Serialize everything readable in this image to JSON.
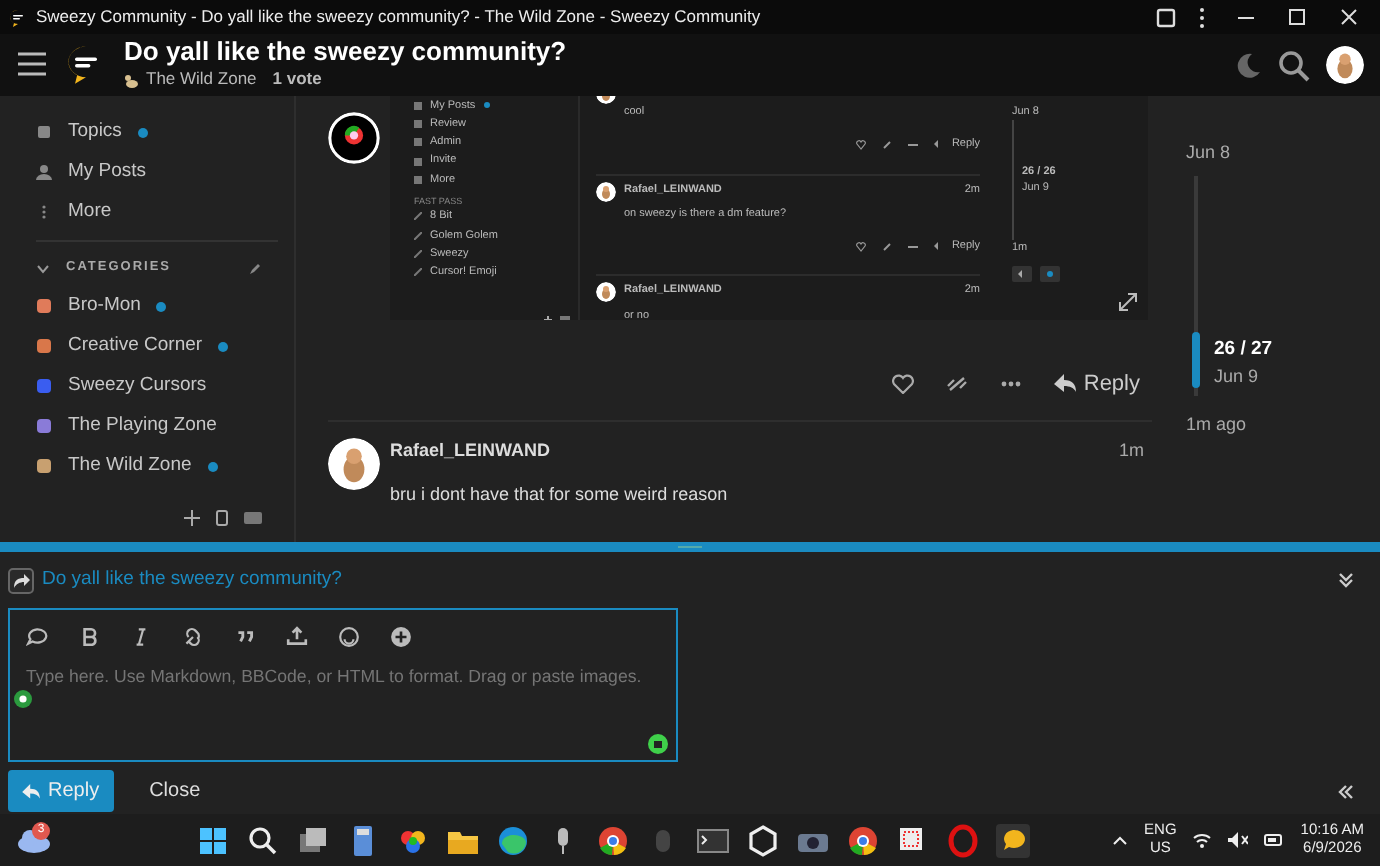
{
  "window": {
    "title": "Sweezy Community - Do yall like the sweezy community? - The Wild Zone - Sweezy Community"
  },
  "header": {
    "title": "Do yall like the sweezy community?",
    "category": "The Wild Zone",
    "votes": "1 vote"
  },
  "sidebar": {
    "items": [
      {
        "label": "Topics",
        "unread": true,
        "kind": "topics"
      },
      {
        "label": "My Posts",
        "unread": false,
        "kind": "user"
      },
      {
        "label": "More",
        "unread": false,
        "kind": "more"
      }
    ],
    "categories_heading": "CATEGORIES",
    "categories": [
      {
        "label": "Bro-Mon",
        "unread": true,
        "color": "#e07b5a"
      },
      {
        "label": "Creative Corner",
        "unread": true,
        "color": "#d9774a"
      },
      {
        "label": "Sweezy Cursors",
        "unread": false,
        "color": "#3a5df0"
      },
      {
        "label": "The Playing Zone",
        "unread": false,
        "color": "#8a7bd8"
      },
      {
        "label": "The Wild Zone",
        "unread": true,
        "color": "#c8a070"
      }
    ]
  },
  "embedded_screenshot": {
    "sidebar": [
      {
        "label": "My Posts",
        "unread": true
      },
      {
        "label": "Review",
        "unread": false
      },
      {
        "label": "Admin",
        "unread": false
      },
      {
        "label": "Invite",
        "unread": false
      },
      {
        "label": "More",
        "unread": false
      }
    ],
    "section": "FAST PASS",
    "links": [
      "8 Bit",
      "Golem Golem",
      "Sweezy",
      "Cursor! Emoji"
    ],
    "posts": [
      {
        "text": "cool",
        "reply": "Reply"
      },
      {
        "author": "Rafael_LEINWAND",
        "time": "2m",
        "text": "on sweezy is there a dm feature?",
        "reply": "Reply"
      },
      {
        "author": "Rafael_LEINWAND",
        "time": "2m",
        "text": "or no"
      }
    ],
    "timeline": {
      "start": "Jun 8",
      "position": "26 / 26",
      "date": "Jun 9",
      "end": "1m"
    }
  },
  "post_actions": {
    "reply": "Reply"
  },
  "reply_post": {
    "author": "Rafael_LEINWAND",
    "time": "1m",
    "text": "bru i dont have that for some weird reason"
  },
  "timeline": {
    "start": "Jun 8",
    "position": "26 / 27",
    "date": "Jun 9",
    "end": "1m ago"
  },
  "composer": {
    "reply_to": "Do yall like the sweezy community?",
    "placeholder": "Type here. Use Markdown, BBCode, or HTML to format. Drag or paste images.",
    "submit": "Reply",
    "cancel": "Close"
  },
  "taskbar": {
    "weather_badge": "3",
    "language": "ENG",
    "region": "US",
    "time": "10:16 AM",
    "date": "6/9/2026"
  }
}
